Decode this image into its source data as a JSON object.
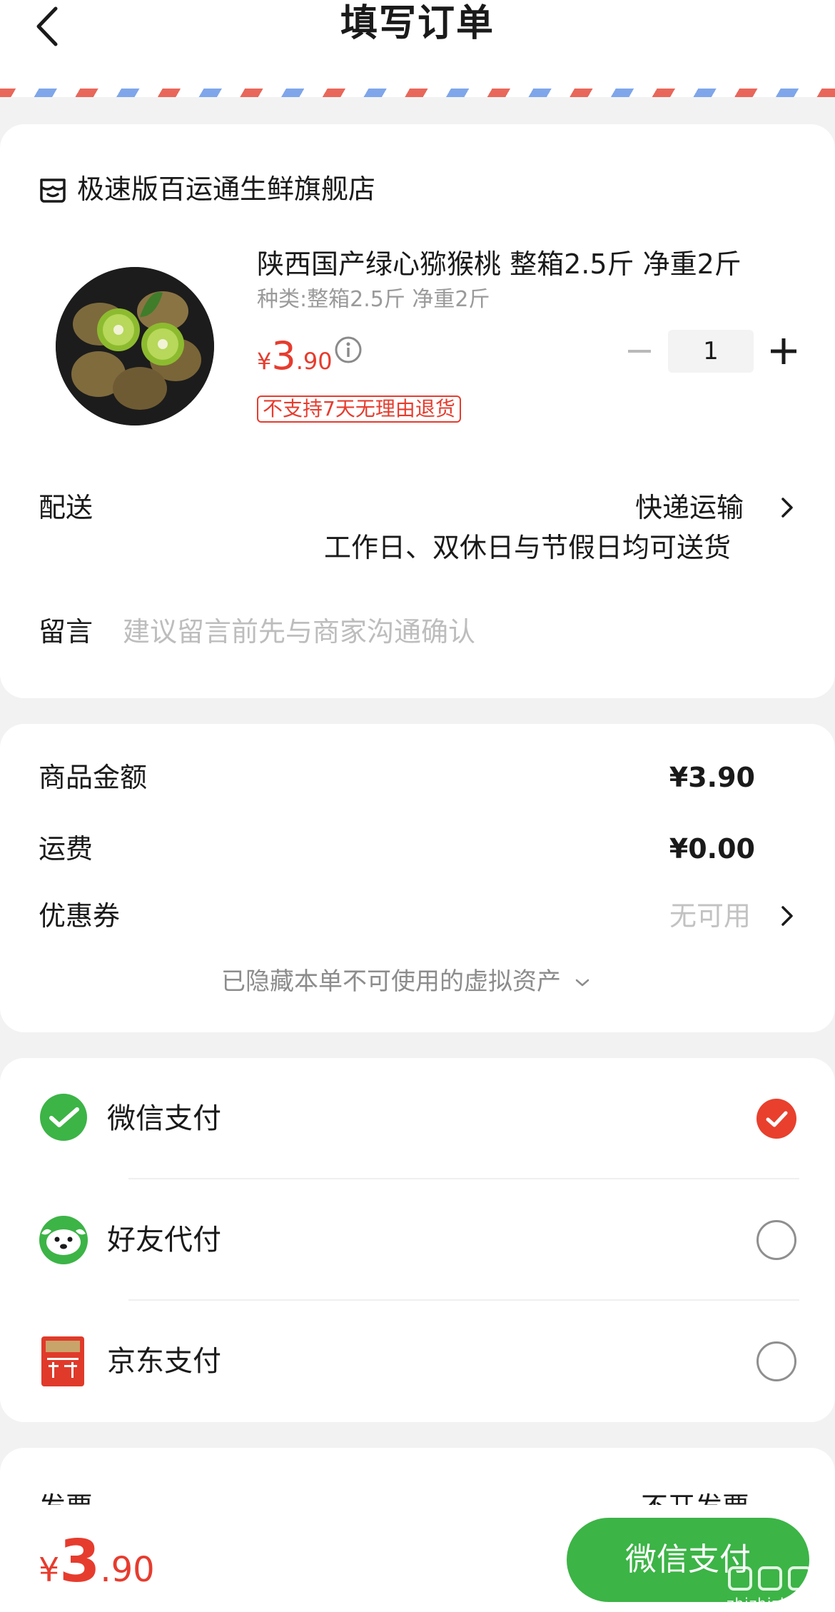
{
  "header": {
    "title": "填写订单"
  },
  "store": {
    "name": "极速版百运通生鲜旗舰店",
    "icon": "store-icon"
  },
  "product": {
    "title": "陕西国产绿心猕猴桃 整箱2.5斤 净重2斤",
    "spec": "种类:整箱2.5斤 净重2斤",
    "price_currency": "¥",
    "price_integer": "3",
    "price_decimal": ".90",
    "quantity": "1",
    "return_policy": "不支持7天无理由退货",
    "image": "kiwi-fruit-plate"
  },
  "delivery": {
    "label": "配送",
    "method": "快递运输",
    "note": "工作日、双休日与节假日均可送货"
  },
  "remark": {
    "label": "留言",
    "placeholder": "建议留言前先与商家沟通确认",
    "value": ""
  },
  "summary": {
    "goods_label": "商品金额",
    "goods_amount": "¥3.90",
    "freight_label": "运费",
    "freight_amount": "¥0.00",
    "coupon_label": "优惠券",
    "coupon_value": "无可用",
    "hidden_assets": "已隐藏本单不可使用的虚拟资产"
  },
  "payment_methods": [
    {
      "label": "微信支付",
      "icon": "wechat-pay-icon",
      "selected": true
    },
    {
      "label": "好友代付",
      "icon": "friend-pay-icon",
      "selected": false
    },
    {
      "label": "京东支付",
      "icon": "jd-pay-icon",
      "selected": false
    }
  ],
  "invoice": {
    "label": "发票",
    "value": "不开发票"
  },
  "footer": {
    "currency": "¥",
    "total_integer": "3",
    "total_decimal": ".90",
    "pay_button": "微信支付"
  },
  "watermark": {
    "text": "zhizhizhi.com"
  },
  "colors": {
    "accent_red": "#e63c2e",
    "wechat_green": "#3cb446",
    "airmail_red": "#e8675a",
    "airmail_blue": "#7fa6ea",
    "background": "#f2f2f2"
  }
}
